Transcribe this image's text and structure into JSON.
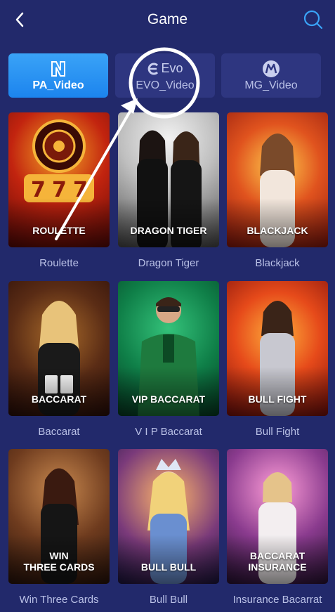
{
  "header": {
    "title": "Game",
    "back_icon": "chevron-left-icon",
    "search_icon": "search-icon"
  },
  "tabs": [
    {
      "label": "PA_Video",
      "icon": "pa-logo-icon",
      "active": true
    },
    {
      "label": "EVO_Video",
      "icon": "evo-logo-icon",
      "logo_text": "Evo",
      "active": false
    },
    {
      "label": "MG_Video",
      "icon": "mg-logo-icon",
      "active": false
    }
  ],
  "games": [
    {
      "banner": "ROULETTE",
      "caption": "Roulette"
    },
    {
      "banner": "DRAGON TIGER",
      "caption": "Dragon Tiger"
    },
    {
      "banner": "BLACKJACK",
      "caption": "Blackjack"
    },
    {
      "banner": "BACCARAT",
      "caption": "Baccarat"
    },
    {
      "banner": "VIP BACCARAT",
      "caption": "V I P Baccarat"
    },
    {
      "banner": "BULL FIGHT",
      "caption": "Bull Fight"
    },
    {
      "banner": "WIN\nTHREE CARDS",
      "caption": "Win Three Cards"
    },
    {
      "banner": "BULL BULL",
      "caption": "Bull Bull"
    },
    {
      "banner": "BACCARAT\nINSURANCE",
      "caption": "Insurance Bacarrat"
    }
  ],
  "colors": {
    "background": "#22296b",
    "tab": "#2e3680",
    "tab_active": "#1c84ee",
    "caption": "#b9c0e6"
  }
}
